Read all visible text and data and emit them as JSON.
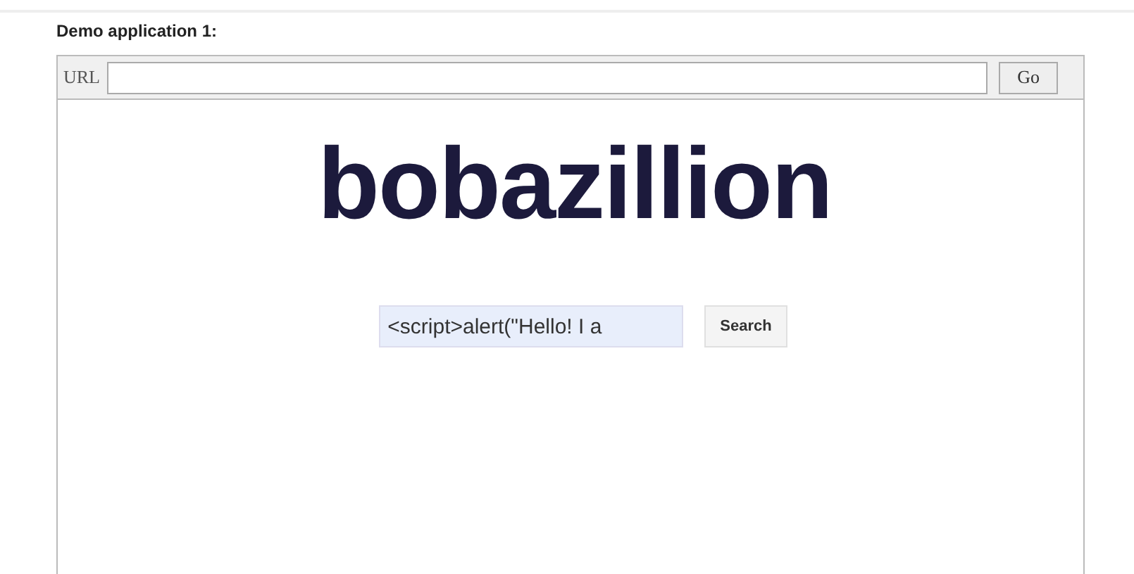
{
  "heading": "Demo application 1:",
  "browser": {
    "url_label": "URL",
    "go_button": "Go"
  },
  "page": {
    "logo": "bobazillion",
    "search_value": "<script>alert(\"Hello! I a",
    "search_button": "Search"
  }
}
